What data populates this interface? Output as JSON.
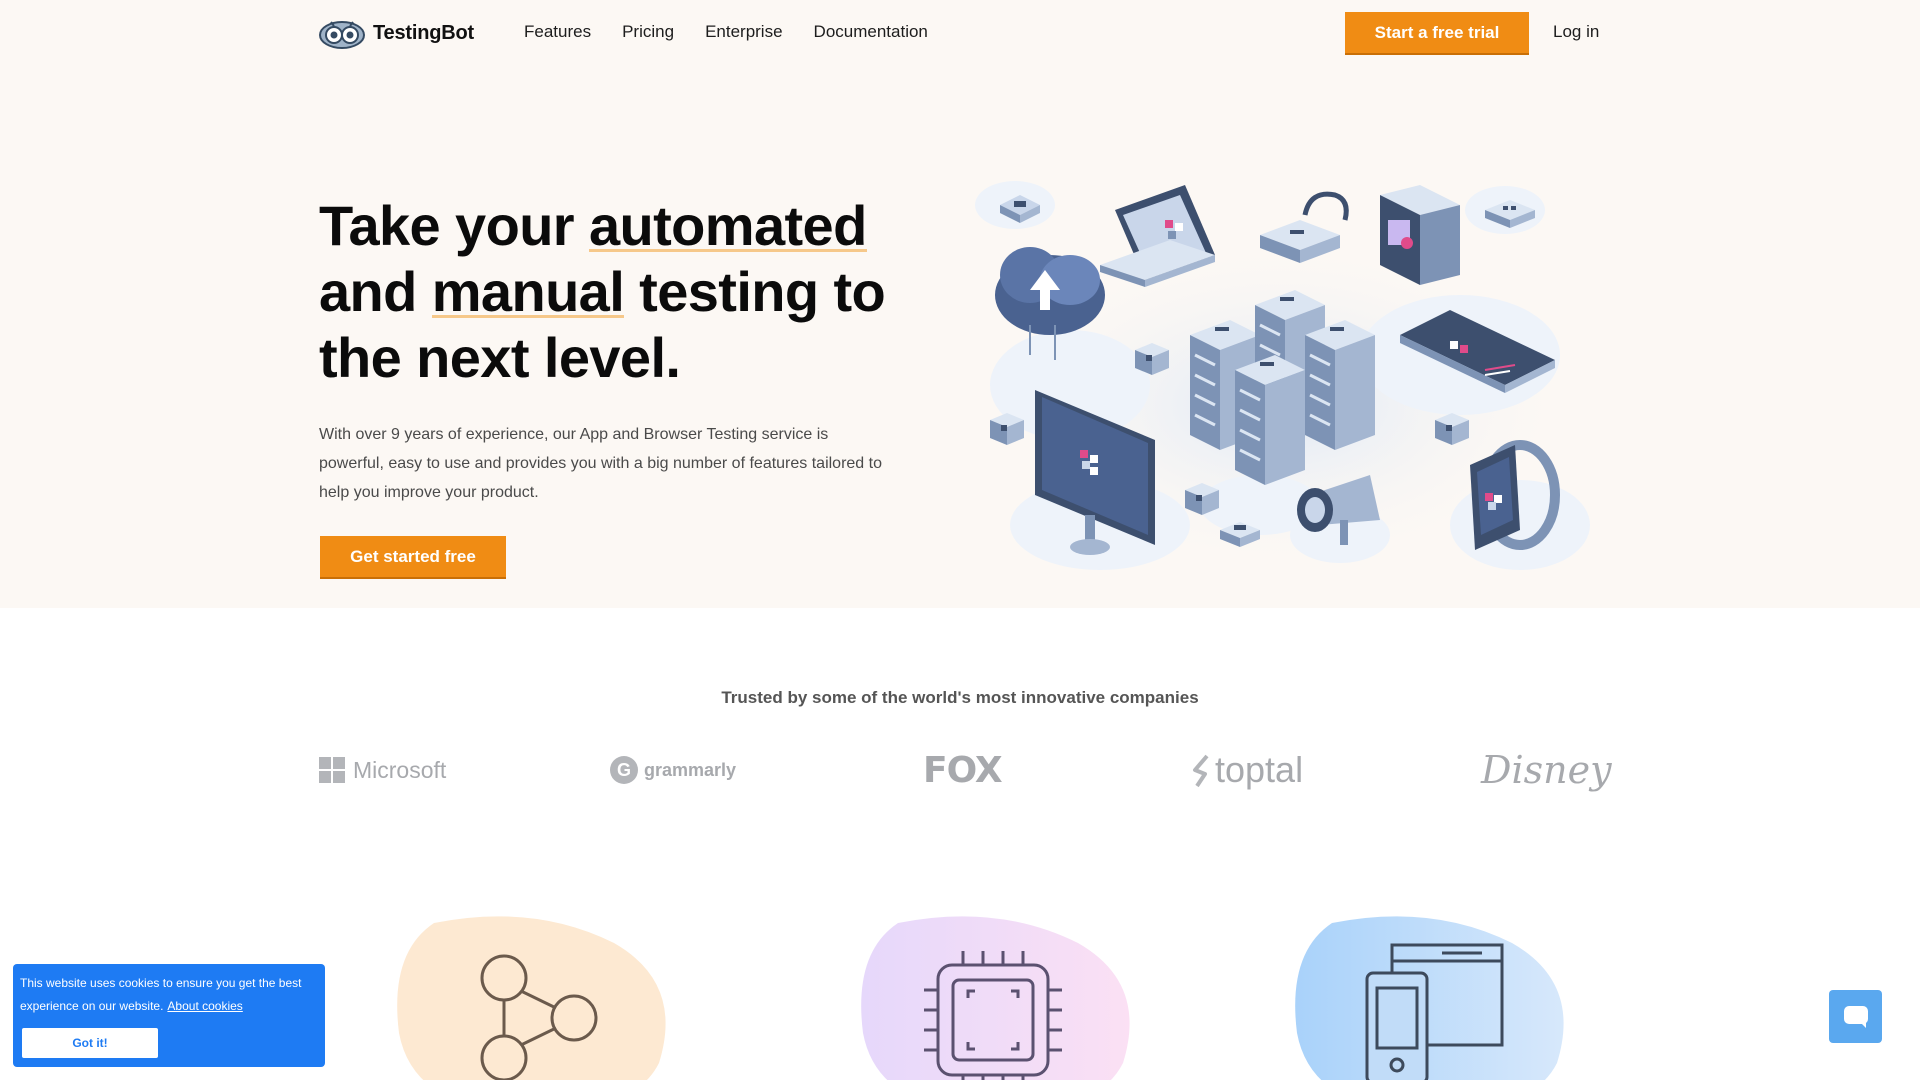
{
  "brand": {
    "name": "TestingBot"
  },
  "nav": {
    "items": [
      {
        "label": "Features"
      },
      {
        "label": "Pricing"
      },
      {
        "label": "Enterprise"
      },
      {
        "label": "Documentation"
      }
    ],
    "cta_label": "Start a free trial",
    "login_label": "Log in"
  },
  "hero": {
    "title_part1": "Take your ",
    "title_hl1": "automated",
    "title_part2": " and ",
    "title_hl2": "manual",
    "title_part3": " testing to the next level.",
    "description": "With over 9 years of experience, our App and Browser Testing service is powerful, easy to use and provides you with a big number of features tailored to help you improve your product.",
    "cta_label": "Get started free"
  },
  "trusted": {
    "heading": "Trusted by some of the world's most innovative companies",
    "logos": [
      {
        "name": "Microsoft"
      },
      {
        "name": "grammarly"
      },
      {
        "name": "FOX"
      },
      {
        "name": "toptal"
      },
      {
        "name": "Disney"
      }
    ]
  },
  "features": {
    "icons": [
      "share-nodes-icon",
      "cpu-chip-icon",
      "mobile-desktop-icon"
    ]
  },
  "cookie": {
    "text": "This website uses cookies to ensure you get the best experience on our website.",
    "link_label": "About cookies",
    "button_label": "Got it!"
  },
  "colors": {
    "accent": "#f08c14",
    "hero_bg": "#fcf8f4",
    "cookie_bg": "#1e7bf3",
    "chat_bg": "#5aa8ef"
  }
}
